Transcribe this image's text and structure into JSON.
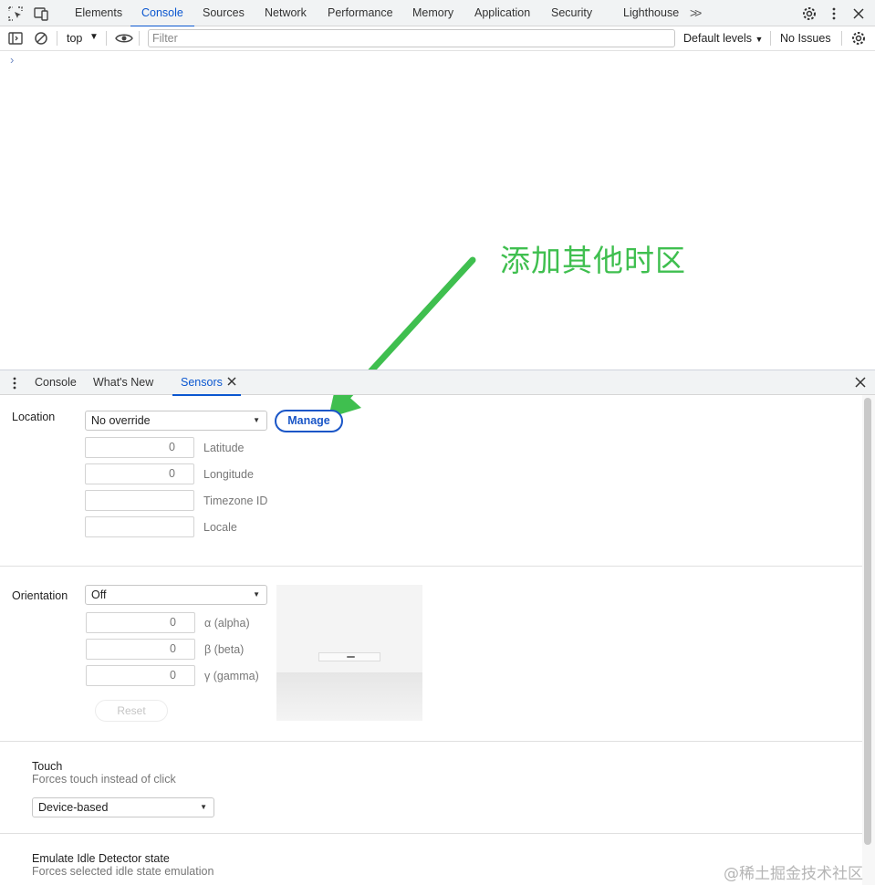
{
  "top_tabs": [
    "Elements",
    "Console",
    "Sources",
    "Network",
    "Performance",
    "Memory",
    "Application",
    "Security",
    "Lighthouse"
  ],
  "active_top_tab": "Console",
  "console_toolbar": {
    "context": "top",
    "filter_placeholder": "Filter",
    "levels_label": "Default levels",
    "issues_label": "No Issues"
  },
  "console_prompt": "›",
  "annotation_text": "添加其他时区",
  "drawer": {
    "tabs": [
      "Console",
      "What's New",
      "Sensors"
    ],
    "active_tab": "Sensors"
  },
  "sensors": {
    "location": {
      "label": "Location",
      "select_value": "No override",
      "manage_label": "Manage",
      "latitude_value": "0",
      "latitude_label": "Latitude",
      "longitude_value": "0",
      "longitude_label": "Longitude",
      "timezone_value": "",
      "timezone_label": "Timezone ID",
      "locale_value": "",
      "locale_label": "Locale"
    },
    "orientation": {
      "label": "Orientation",
      "select_value": "Off",
      "alpha_value": "0",
      "alpha_label": "α (alpha)",
      "beta_value": "0",
      "beta_label": "β (beta)",
      "gamma_value": "0",
      "gamma_label": "γ (gamma)",
      "reset_label": "Reset"
    },
    "touch": {
      "title": "Touch",
      "subtitle": "Forces touch instead of click",
      "select_value": "Device-based"
    },
    "idle": {
      "title": "Emulate Idle Detector state",
      "subtitle": "Forces selected idle state emulation"
    }
  },
  "watermark": "@稀土掘金技术社区",
  "colors": {
    "accent": "#0b57d0",
    "annotation": "#3fbf4f",
    "manage_border": "#1a56c7"
  }
}
